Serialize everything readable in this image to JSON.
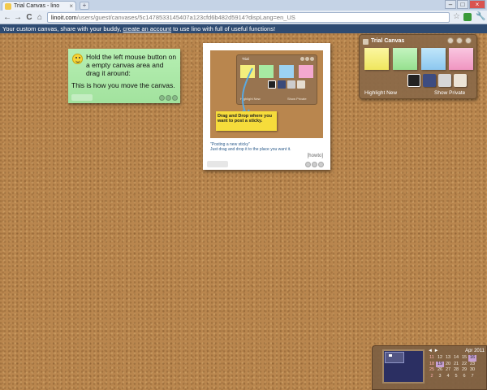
{
  "browser": {
    "tab_title": "Trial Canvas - lino",
    "tab_close": "×",
    "new_tab": "+",
    "url_host": "linoit.com",
    "url_path": "/users/guest/canvases/5c1478533145407a123cfd6b482d5914?dispLang=en_US",
    "nav": {
      "back": "←",
      "forward": "→",
      "reload": "C",
      "home": "⌂"
    },
    "window_controls": {
      "minimize": "–",
      "maximize": "□",
      "close": "×"
    },
    "star": "☆",
    "wrench": "🔧"
  },
  "infobar": {
    "text_before": "Your custom canvas, share with your buddy,",
    "link": "create an account",
    "text_after": "to use lino with full of useful functions!"
  },
  "green_sticky": {
    "line1": "Hold the left mouse button on a empty canvas area and drag it around:",
    "line2": "This is how you move the canvas."
  },
  "howto_sticky": {
    "mini_title": "Trial",
    "drag_text": "Drag and Drop where you want to post a sticky.",
    "mini_highlight": "Highlight New",
    "mini_private": "Show Private",
    "caption": "\"Posting a new sticky\"\nJust drag and drop it to the place you want it.",
    "tag": "[howto]"
  },
  "palette": {
    "title": "Trial Canvas",
    "highlight_new": "Highlight New",
    "show_private": "Show Private",
    "sticky_colors": [
      "#f4ef7c",
      "#a7eaa2",
      "#9cd2f2",
      "#f4a8cf"
    ]
  },
  "calendar": {
    "month": "Apr 2011",
    "nav_prev": "◄",
    "nav_next": "►",
    "rows": [
      [
        "",
        "",
        "",
        "",
        "",
        "",
        ""
      ],
      [
        "11",
        "12",
        "13",
        "14",
        "15",
        "16",
        ""
      ],
      [
        "18",
        "19",
        "20",
        "21",
        "22",
        "23",
        ""
      ],
      [
        "25",
        "26",
        "27",
        "28",
        "29",
        "30",
        ""
      ],
      [
        "2",
        "3",
        "4",
        "5",
        "6",
        "7",
        ""
      ]
    ]
  }
}
